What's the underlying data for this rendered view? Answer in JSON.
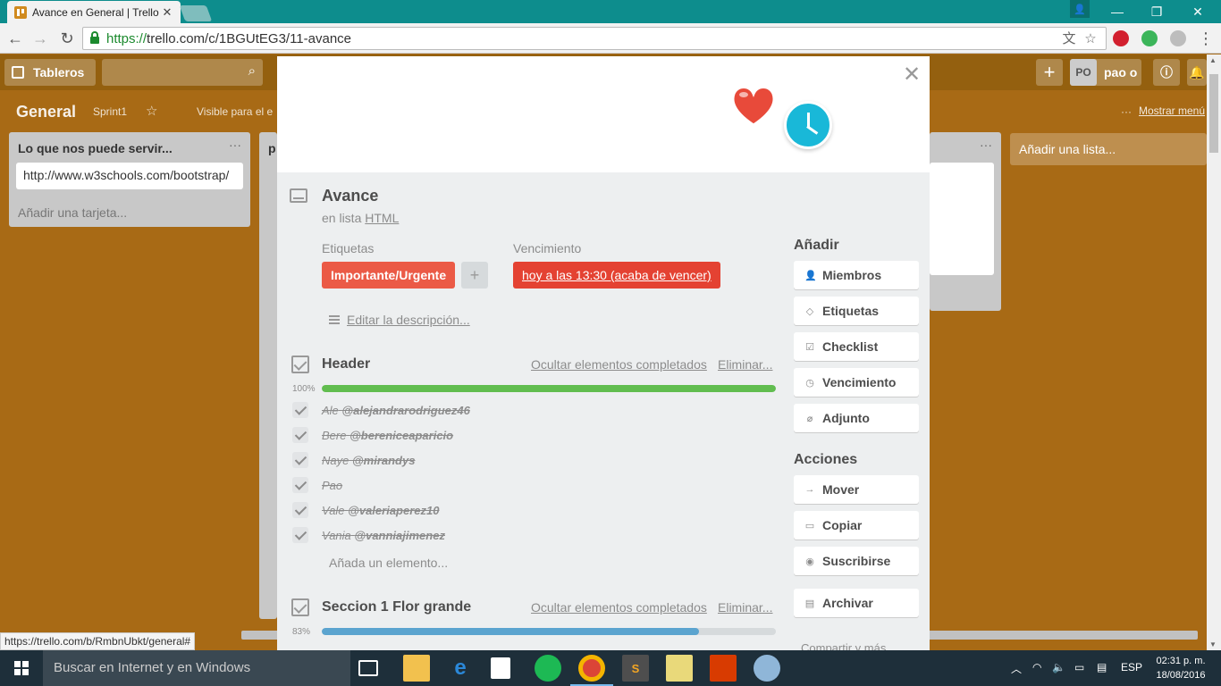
{
  "browser": {
    "tab_title": "Avance en General | Trello",
    "url_scheme": "https://",
    "url_rest": "trello.com/c/1BGUtEG3/11-avance",
    "status_url": "https://trello.com/b/RmbnUbkt/general#"
  },
  "trello": {
    "boards_label": "Tableros",
    "user_initials": "PO",
    "user_name": "pao o",
    "board_title": "General",
    "sprint": "Sprint1",
    "visibility": "Visible para el e",
    "show_menu": "Mostrar menú",
    "add_list": "Añadir una lista...",
    "list1": {
      "title": "Lo que nos puede servir...",
      "card": "http://www.w3schools.com/bootstrap/",
      "add_card": "Añadir una tarjeta..."
    },
    "list2_title": "p"
  },
  "card": {
    "title": "Avance",
    "in_list_prefix": "en lista",
    "list_name": "HTML",
    "labels_heading": "Etiquetas",
    "label": "Importante/Urgente",
    "label_add": "+",
    "due_heading": "Vencimiento",
    "due": "hoy a las 13:30 (acaba de vencer)",
    "edit_description": "Editar la descripción...",
    "checklists": [
      {
        "title": "Header",
        "hide_completed": "Ocultar elementos completados",
        "delete": "Eliminar...",
        "percent": "100%",
        "progress": 1.0,
        "items": [
          {
            "name": "Ale",
            "mention": "@alejandrarodriguez46"
          },
          {
            "name": "Bere",
            "mention": "@bereniceaparicio"
          },
          {
            "name": "Naye",
            "mention": "@mirandys"
          },
          {
            "name": "Pao",
            "mention": ""
          },
          {
            "name": "Vale",
            "mention": "@valeriaperez10"
          },
          {
            "name": "Vania",
            "mention": "@vanniajimenez"
          }
        ],
        "add_item": "Añada un elemento..."
      },
      {
        "title": "Seccion 1 Flor grande",
        "hide_completed": "Ocultar elementos completados",
        "delete": "Eliminar...",
        "percent": "83%",
        "progress": 0.83
      }
    ],
    "sidebar": {
      "add_heading": "Añadir",
      "add_buttons": [
        "Miembros",
        "Etiquetas",
        "Checklist",
        "Vencimiento",
        "Adjunto"
      ],
      "actions_heading": "Acciones",
      "action_buttons": [
        "Mover",
        "Copiar",
        "Suscribirse",
        "Archivar"
      ],
      "share_more": "Compartir y más..."
    }
  },
  "taskbar": {
    "search_placeholder": "Buscar en Internet y en Windows",
    "language": "ESP",
    "time": "02:31 p. m.",
    "date": "18/08/2016"
  },
  "colors": {
    "label_red": "#eb5a46",
    "due_red": "#e44232",
    "progress_green": "#61bd4f",
    "progress_blue": "#5ba4cf",
    "board_bg": "#a86a15"
  }
}
